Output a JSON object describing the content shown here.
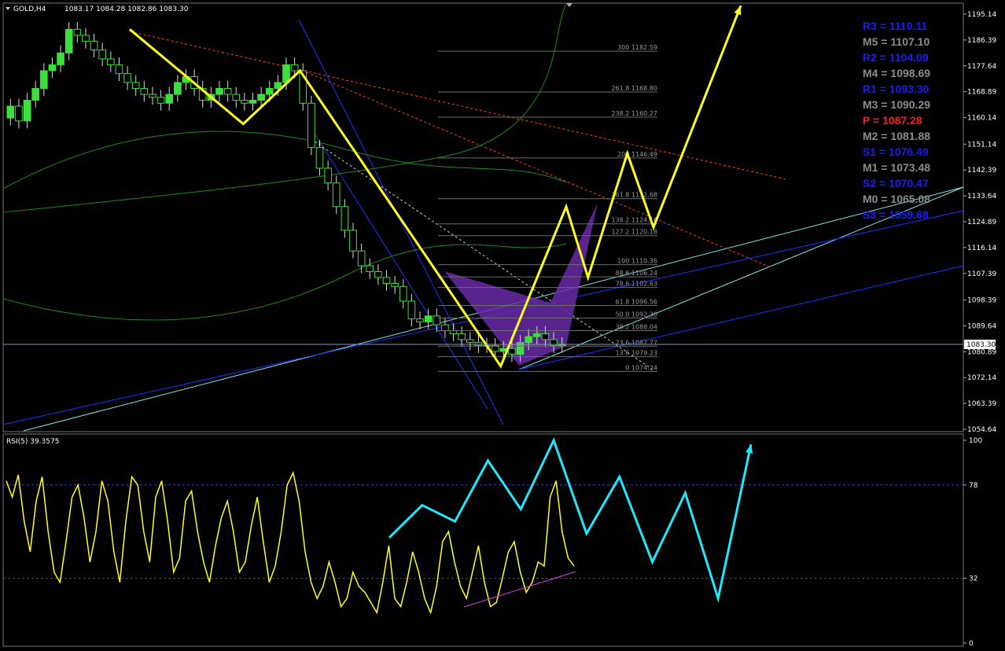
{
  "header": {
    "symbol": "GOLD,H4",
    "ohlc": "1083.17 1084.28 1082.86 1083.30",
    "current_price": "1083.30"
  },
  "pivots": [
    {
      "label": "R3 = 1110.11",
      "color": "#1a1aff"
    },
    {
      "label": "M5 = 1107.10",
      "color": "#8c8c8c"
    },
    {
      "label": "R2 = 1104.09",
      "color": "#1a1aff"
    },
    {
      "label": "M4 = 1098.69",
      "color": "#8c8c8c"
    },
    {
      "label": "R1 = 1093.30",
      "color": "#1a1aff"
    },
    {
      "label": "M3 = 1090.29",
      "color": "#8c8c8c"
    },
    {
      "label": "P   = 1087.28",
      "color": "#ff1a1a"
    },
    {
      "label": "M2 = 1081.88",
      "color": "#8c8c8c"
    },
    {
      "label": "S1 = 1076.49",
      "color": "#1a1aff"
    },
    {
      "label": "M1 = 1073.48",
      "color": "#8c8c8c"
    },
    {
      "label": "S2 = 1070.47",
      "color": "#1a1aff"
    },
    {
      "label": "M0 = 1065.08",
      "color": "#8c8c8c"
    },
    {
      "label": "S3 = 1059.68",
      "color": "#1a1aff"
    }
  ],
  "chart_data": [
    {
      "type": "candlestick",
      "symbol": "GOLD",
      "timeframe": "H4",
      "ylim": [
        1050,
        1198
      ],
      "y_ticks": [
        "1195.14",
        "1186.39",
        "1177.64",
        "1168.89",
        "1160.14",
        "1151.14",
        "1142.39",
        "1133.64",
        "1124.89",
        "1116.14",
        "1107.39",
        "1098.39",
        "1089.64",
        "1080.89",
        "1072.14",
        "1063.39",
        "1054.64"
      ],
      "fib_levels": [
        {
          "label": "300 1182.59",
          "price": 1182.59
        },
        {
          "label": "261.8 1168.80",
          "price": 1168.8
        },
        {
          "label": "238.2 1160.27",
          "price": 1160.27
        },
        {
          "label": "200 1146.49",
          "price": 1146.49
        },
        {
          "label": "161.8 1132.68",
          "price": 1132.68
        },
        {
          "label": "138.2 1124.16",
          "price": 1124.16
        },
        {
          "label": "127.2 1120.18",
          "price": 1120.18
        },
        {
          "label": "100 1110.36",
          "price": 1110.36
        },
        {
          "label": "88.6 1106.24",
          "price": 1106.24
        },
        {
          "label": "78.6 1102.63",
          "price": 1102.63
        },
        {
          "label": "61.8 1096.56",
          "price": 1096.56
        },
        {
          "label": "50.0 1092.30",
          "price": 1092.3
        },
        {
          "label": "38.2 1088.04",
          "price": 1088.04
        },
        {
          "label": "23.6 1082.77",
          "price": 1082.77
        },
        {
          "label": "13.6 1079.23",
          "price": 1079.23
        },
        {
          "label": "0 1074.24",
          "price": 1074.24
        }
      ],
      "price_path": [
        1160,
        1164,
        1159,
        1166,
        1170,
        1176,
        1178,
        1182,
        1190,
        1188,
        1186,
        1183,
        1180,
        1178,
        1175,
        1172,
        1170,
        1168,
        1167,
        1165,
        1168,
        1172,
        1174,
        1170,
        1166,
        1168,
        1170,
        1168,
        1166,
        1165,
        1166,
        1168,
        1170,
        1172,
        1178,
        1176,
        1165,
        1150,
        1143,
        1138,
        1130,
        1122,
        1115,
        1110,
        1108,
        1106,
        1104,
        1103,
        1098,
        1092,
        1091,
        1093,
        1090,
        1088,
        1087,
        1085,
        1084,
        1083,
        1083,
        1081,
        1082,
        1080,
        1084,
        1086,
        1087,
        1085,
        1083,
        1083.3
      ],
      "projection_path": [
        {
          "t": 0,
          "price": 1190
        },
        {
          "t": 0.26,
          "price": 1158
        },
        {
          "t": 0.39,
          "price": 1176
        },
        {
          "t": 0.85,
          "price": 1076
        },
        {
          "t": 1.0,
          "price": 1130
        },
        {
          "t": 1.05,
          "price": 1106
        },
        {
          "t": 1.14,
          "price": 1148
        },
        {
          "t": 1.2,
          "price": 1123
        },
        {
          "t": 1.4,
          "price": 1198
        }
      ]
    },
    {
      "type": "line",
      "title": "RSI(5) 39.3575",
      "ylim": [
        0,
        100
      ],
      "y_ticks": [
        "100",
        "78",
        "32",
        "0"
      ],
      "levels": [
        78,
        32
      ],
      "values": [
        80,
        72,
        83,
        60,
        45,
        70,
        82,
        55,
        35,
        30,
        50,
        72,
        78,
        62,
        40,
        55,
        80,
        70,
        45,
        30,
        60,
        82,
        78,
        55,
        40,
        72,
        80,
        60,
        35,
        42,
        70,
        75,
        55,
        40,
        30,
        48,
        62,
        70,
        55,
        35,
        40,
        58,
        72,
        50,
        30,
        38,
        55,
        78,
        84,
        70,
        45,
        30,
        22,
        28,
        40,
        30,
        18,
        22,
        35,
        28,
        25,
        20,
        15,
        30,
        48,
        22,
        18,
        30,
        45,
        35,
        22,
        15,
        28,
        50,
        55,
        40,
        28,
        22,
        35,
        48,
        30,
        18,
        20,
        32,
        45,
        50,
        35,
        25,
        30,
        40,
        38,
        72,
        80,
        55,
        42,
        38
      ],
      "projection": [
        52,
        68,
        60,
        90,
        66,
        100,
        54,
        82,
        40,
        74,
        22,
        98
      ]
    }
  ]
}
